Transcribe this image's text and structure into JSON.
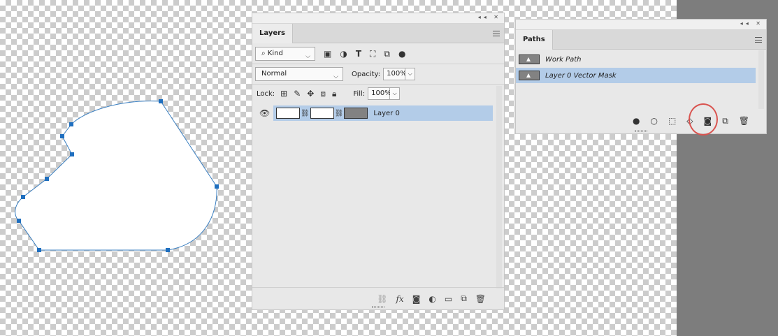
{
  "layers_panel": {
    "tab": "Layers",
    "filter_kind": "Kind",
    "blend_mode": "Normal",
    "opacity_label": "Opacity:",
    "opacity_value": "100%",
    "lock_label": "Lock:",
    "fill_label": "Fill:",
    "fill_value": "100%",
    "layers": [
      {
        "name": "Layer 0",
        "selected": true
      }
    ],
    "bottom_icons": [
      "link-icon",
      "fx-icon",
      "mask-icon",
      "adjustment-icon",
      "folder-icon",
      "new-layer-icon",
      "trash-icon"
    ],
    "fx_label": "fx"
  },
  "paths_panel": {
    "tab": "Paths",
    "paths": [
      {
        "name": "Work Path",
        "selected": false
      },
      {
        "name": "Layer 0 Vector Mask",
        "selected": true
      }
    ],
    "bottom_icons": [
      "fill-path-icon",
      "stroke-path-icon",
      "selection-icon",
      "work-path-icon",
      "add-mask-icon",
      "new-path-icon",
      "trash-icon"
    ]
  },
  "colors": {
    "selection": "#b3cce8",
    "path_stroke": "#3a7fc1",
    "anchor": "#1f6fbf",
    "highlight": "#d9534f"
  }
}
